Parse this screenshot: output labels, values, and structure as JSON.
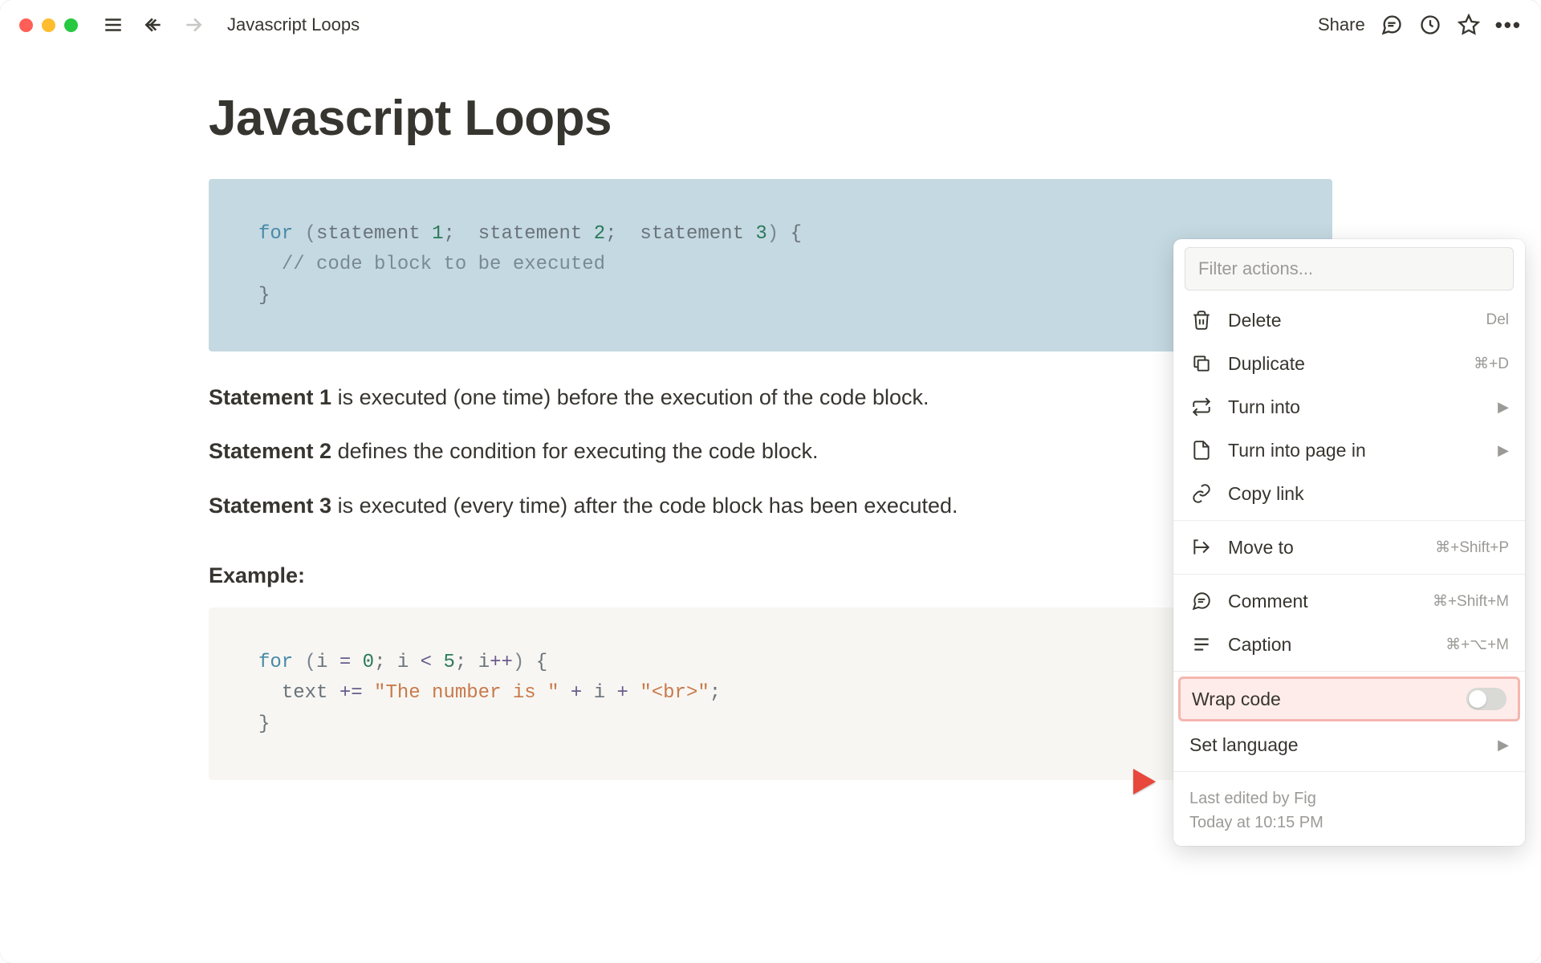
{
  "topbar": {
    "breadcrumb": "Javascript Loops",
    "share": "Share"
  },
  "page": {
    "title": "Javascript Loops",
    "code1": {
      "raw_html": "<span class='tok-kw'>for</span> <span class='tok-paren'>(</span><span class='tok-txt'>statement </span><span class='tok-num'>1</span><span class='tok-txt'>; </span> <span class='tok-txt'>statement </span><span class='tok-num'>2</span><span class='tok-txt'>; </span> <span class='tok-txt'>statement </span><span class='tok-num'>3</span><span class='tok-paren'>)</span> <span class='tok-txt'>{</span>\n  <span class='tok-comment'>// code block to be executed</span>\n<span class='tok-txt'>}</span>"
    },
    "statements": [
      {
        "label": "Statement 1",
        "text": " is executed (one time) before the execution of the code block."
      },
      {
        "label": "Statement 2",
        "text": " defines the condition for executing the code block."
      },
      {
        "label": "Statement 3",
        "text": " is executed (every time) after the code block has been executed."
      }
    ],
    "example_label": "Example:",
    "code2": {
      "raw_html": "<span class='tok-kw'>for</span> <span class='tok-paren'>(</span><span class='tok-txt'>i </span><span class='tok-op'>=</span> <span class='tok-num'>0</span><span class='tok-txt'>; i </span><span class='tok-op'>&lt;</span> <span class='tok-num'>5</span><span class='tok-txt'>; i</span><span class='tok-op'>++</span><span class='tok-paren'>)</span> <span class='tok-txt'>{</span>\n  <span class='tok-txt'>text </span><span class='tok-op'>+=</span> <span class='tok-str'>\"The number is \"</span> <span class='tok-op'>+</span> <span class='tok-txt'>i</span> <span class='tok-op'>+</span> <span class='tok-str'>\"&lt;br&gt;\"</span><span class='tok-txt'>;</span>\n<span class='tok-txt'>}</span>"
    }
  },
  "contextMenu": {
    "filter_placeholder": "Filter actions...",
    "items": [
      {
        "id": "delete",
        "label": "Delete",
        "kbd": "Del"
      },
      {
        "id": "duplicate",
        "label": "Duplicate",
        "kbd": "⌘+D"
      },
      {
        "id": "turn-into",
        "label": "Turn into",
        "chevron": true
      },
      {
        "id": "turn-into-page",
        "label": "Turn into page in",
        "chevron": true
      },
      {
        "id": "copy-link",
        "label": "Copy link"
      },
      {
        "divider": true
      },
      {
        "id": "move-to",
        "label": "Move to",
        "kbd": "⌘+Shift+P"
      },
      {
        "divider": true
      },
      {
        "id": "comment",
        "label": "Comment",
        "kbd": "⌘+Shift+M"
      },
      {
        "id": "caption",
        "label": "Caption",
        "kbd": "⌘+⌥+M"
      },
      {
        "divider": true
      },
      {
        "id": "wrap-code",
        "label": "Wrap code",
        "toggle": true,
        "highlighted": true
      },
      {
        "id": "set-language",
        "label": "Set language",
        "chevron": true
      }
    ],
    "footer_line1": "Last edited by Fig",
    "footer_line2": "Today at 10:15 PM"
  }
}
